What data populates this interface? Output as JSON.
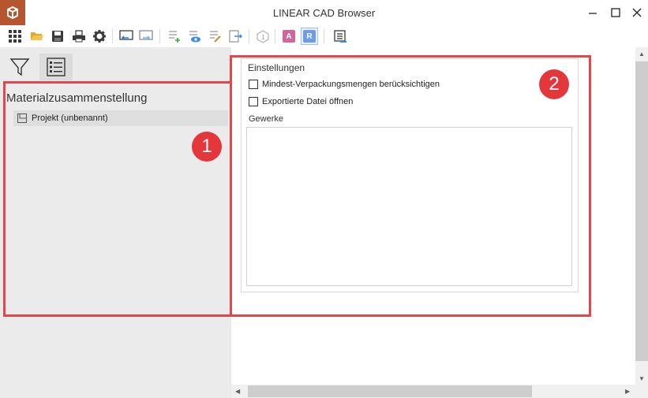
{
  "window": {
    "title": "LINEAR CAD Browser",
    "controls": [
      "minimize",
      "maximize",
      "close"
    ]
  },
  "toolbar": {
    "icons": [
      "grid-icon",
      "folder-open-icon",
      "save-icon",
      "print-icon",
      "gear-icon",
      "import-icon",
      "export-icon",
      "list-add-icon",
      "list-view-icon",
      "list-edit-icon",
      "list-export-icon",
      "object-icon",
      "architecture-icon",
      "r-icon",
      "list-transfer-icon"
    ],
    "a_label": "A",
    "r_label": "R",
    "colors": {
      "a": "#d0679a",
      "r": "#6f9ce8"
    }
  },
  "left_panel": {
    "tabs": [
      "filter",
      "list"
    ],
    "active_tab": "list",
    "section_title": "Materialzusammenstellung",
    "tree_item": "Projekt (unbenannt)"
  },
  "settings": {
    "group_title": "Einstellungen",
    "options": [
      {
        "label": "Mindest-Verpackungsmengen berücksichtigen",
        "checked": false
      },
      {
        "label": "Exportierte Datei öffnen",
        "checked": false
      }
    ],
    "gewerke_label": "Gewerke"
  },
  "callouts": [
    {
      "label": "1"
    },
    {
      "label": "2"
    }
  ],
  "accent": "#e3373c"
}
